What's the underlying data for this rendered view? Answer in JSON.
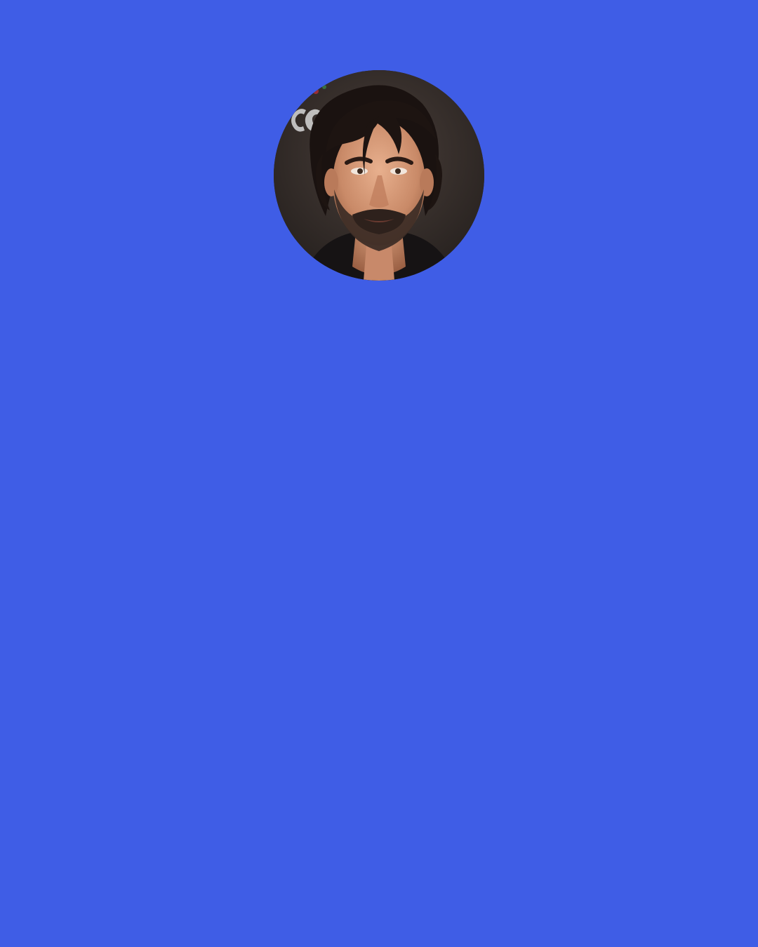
{
  "page": {
    "background_color": "#3f5de6"
  },
  "avatar": {
    "kind": "portrait-photo",
    "subject": "man-with-dark-wavy-hair-and-beard",
    "backdrop_color": "#2b2624"
  }
}
